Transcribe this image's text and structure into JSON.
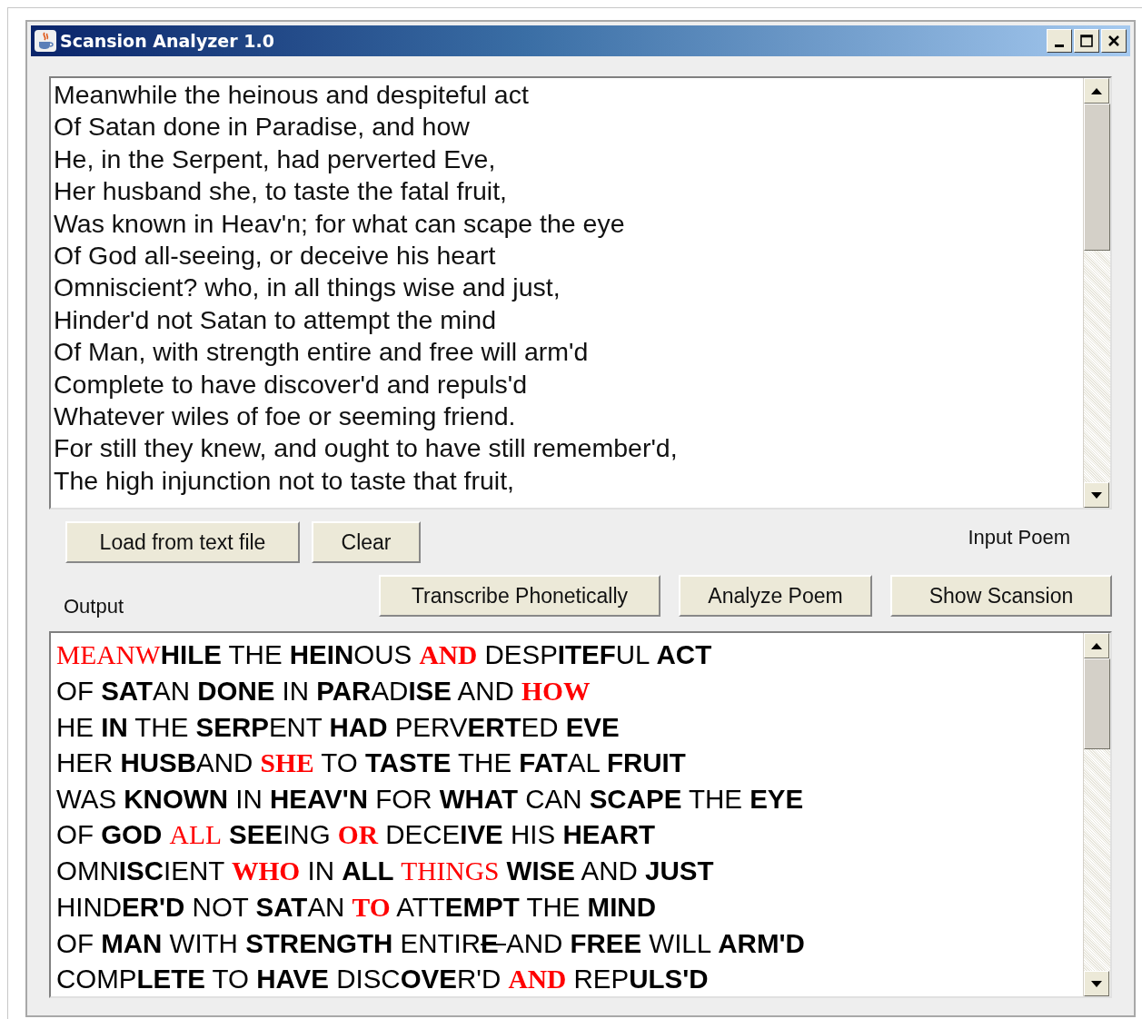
{
  "window": {
    "title": "Scansion Analyzer 1.0"
  },
  "input_poem": {
    "lines": [
      "Meanwhile the heinous and despiteful act",
      "Of Satan done in Paradise, and how",
      "He, in the Serpent, had perverted Eve,",
      "Her husband she, to taste the fatal fruit,",
      "Was known in Heav'n; for what can scape the eye",
      "Of God all-seeing, or deceive his heart",
      "Omniscient? who, in all things wise and just,",
      "Hinder'd not Satan to attempt the mind",
      "Of Man, with strength entire and free will arm'd",
      "Complete to have discover'd and repuls'd",
      "Whatever wiles of foe or seeming friend.",
      "For still they knew, and ought to have still remember'd,",
      "The high injunction not to taste that fruit,"
    ]
  },
  "input_buttons": [
    {
      "label": "Load from text file"
    },
    {
      "label": "Clear"
    }
  ],
  "input_label": "Input Poem",
  "output_label": "Output",
  "output_buttons": [
    {
      "label": "Transcribe Phonetically"
    },
    {
      "label": "Analyze Poem"
    },
    {
      "label": "Show Scansion"
    }
  ],
  "output": {
    "lines": [
      {
        "segments": [
          {
            "text": "MEANW",
            "kind": "red"
          },
          {
            "text": "HILE",
            "kind": "bold"
          },
          {
            "text": " THE ",
            "kind": "plain"
          },
          {
            "text": "HEIN",
            "kind": "bold"
          },
          {
            "text": "OUS ",
            "kind": "plain"
          },
          {
            "text": "AND",
            "kind": "red-bold"
          },
          {
            "text": " DESP",
            "kind": "plain"
          },
          {
            "text": "ITEF",
            "kind": "bold"
          },
          {
            "text": "UL ",
            "kind": "plain"
          },
          {
            "text": "ACT",
            "kind": "bold"
          }
        ]
      },
      {
        "segments": [
          {
            "text": "OF ",
            "kind": "plain"
          },
          {
            "text": "SAT",
            "kind": "bold"
          },
          {
            "text": "AN ",
            "kind": "plain"
          },
          {
            "text": "DONE",
            "kind": "bold"
          },
          {
            "text": " IN ",
            "kind": "plain"
          },
          {
            "text": "PAR",
            "kind": "bold"
          },
          {
            "text": "AD",
            "kind": "plain"
          },
          {
            "text": "ISE",
            "kind": "bold"
          },
          {
            "text": " AND ",
            "kind": "plain"
          },
          {
            "text": "HOW",
            "kind": "red-bold"
          }
        ]
      },
      {
        "segments": [
          {
            "text": "HE ",
            "kind": "plain"
          },
          {
            "text": "IN",
            "kind": "bold"
          },
          {
            "text": " THE ",
            "kind": "plain"
          },
          {
            "text": "SERP",
            "kind": "bold"
          },
          {
            "text": "ENT ",
            "kind": "plain"
          },
          {
            "text": "HAD",
            "kind": "bold"
          },
          {
            "text": " PERV",
            "kind": "plain"
          },
          {
            "text": "ERT",
            "kind": "bold"
          },
          {
            "text": "ED ",
            "kind": "plain"
          },
          {
            "text": "EVE",
            "kind": "bold"
          }
        ]
      },
      {
        "segments": [
          {
            "text": "HER ",
            "kind": "plain"
          },
          {
            "text": "HUSB",
            "kind": "bold"
          },
          {
            "text": "AND ",
            "kind": "plain"
          },
          {
            "text": "SHE",
            "kind": "red-bold"
          },
          {
            "text": " TO ",
            "kind": "plain"
          },
          {
            "text": "TASTE",
            "kind": "bold"
          },
          {
            "text": " THE ",
            "kind": "plain"
          },
          {
            "text": "FAT",
            "kind": "bold"
          },
          {
            "text": "AL ",
            "kind": "plain"
          },
          {
            "text": "FRUIT",
            "kind": "bold"
          }
        ]
      },
      {
        "segments": [
          {
            "text": "WAS ",
            "kind": "plain"
          },
          {
            "text": "KNOWN",
            "kind": "bold"
          },
          {
            "text": " IN ",
            "kind": "plain"
          },
          {
            "text": "HEAV'N",
            "kind": "bold"
          },
          {
            "text": " FOR ",
            "kind": "plain"
          },
          {
            "text": "WHAT",
            "kind": "bold"
          },
          {
            "text": " CAN ",
            "kind": "plain"
          },
          {
            "text": "SCAPE",
            "kind": "bold"
          },
          {
            "text": " THE ",
            "kind": "plain"
          },
          {
            "text": "EYE",
            "kind": "bold"
          }
        ]
      },
      {
        "segments": [
          {
            "text": "OF ",
            "kind": "plain"
          },
          {
            "text": "GOD ",
            "kind": "bold"
          },
          {
            "text": "ALL",
            "kind": "red"
          },
          {
            "text": " SEE",
            "kind": "bold"
          },
          {
            "text": "ING ",
            "kind": "plain"
          },
          {
            "text": "OR",
            "kind": "red-bold"
          },
          {
            "text": " DECE",
            "kind": "plain"
          },
          {
            "text": "IVE",
            "kind": "bold"
          },
          {
            "text": " HIS ",
            "kind": "plain"
          },
          {
            "text": "HEART",
            "kind": "bold"
          }
        ]
      },
      {
        "segments": [
          {
            "text": "OMN",
            "kind": "plain"
          },
          {
            "text": "ISC",
            "kind": "bold"
          },
          {
            "text": "IENT ",
            "kind": "plain"
          },
          {
            "text": "WHO",
            "kind": "red-bold"
          },
          {
            "text": " IN ",
            "kind": "plain"
          },
          {
            "text": "ALL ",
            "kind": "bold"
          },
          {
            "text": "THINGS",
            "kind": "red"
          },
          {
            "text": " WISE",
            "kind": "bold"
          },
          {
            "text": " AND ",
            "kind": "plain"
          },
          {
            "text": "JUST",
            "kind": "bold"
          }
        ]
      },
      {
        "segments": [
          {
            "text": "HIND",
            "kind": "plain"
          },
          {
            "text": "ER'D",
            "kind": "bold"
          },
          {
            "text": " NOT ",
            "kind": "plain"
          },
          {
            "text": "SAT",
            "kind": "bold"
          },
          {
            "text": "AN ",
            "kind": "plain"
          },
          {
            "text": "TO",
            "kind": "red-bold"
          },
          {
            "text": " ATT",
            "kind": "plain"
          },
          {
            "text": "EMPT",
            "kind": "bold"
          },
          {
            "text": " THE ",
            "kind": "plain"
          },
          {
            "text": "MIND",
            "kind": "bold"
          }
        ]
      },
      {
        "segments": [
          {
            "text": "OF ",
            "kind": "plain"
          },
          {
            "text": "MAN",
            "kind": "bold"
          },
          {
            "text": " WITH ",
            "kind": "plain"
          },
          {
            "text": "STRENGTH",
            "kind": "bold"
          },
          {
            "text": " ENTIR",
            "kind": "plain"
          },
          {
            "text": "E ",
            "kind": "bold-struck"
          },
          {
            "text": "AND ",
            "kind": "plain"
          },
          {
            "text": "FREE",
            "kind": "bold"
          },
          {
            "text": " WILL ",
            "kind": "plain"
          },
          {
            "text": "ARM'D",
            "kind": "bold"
          }
        ]
      },
      {
        "segments": [
          {
            "text": "COMP",
            "kind": "plain"
          },
          {
            "text": "LETE",
            "kind": "bold"
          },
          {
            "text": " TO ",
            "kind": "plain"
          },
          {
            "text": "HAVE",
            "kind": "bold"
          },
          {
            "text": " DISC",
            "kind": "plain"
          },
          {
            "text": "OVE",
            "kind": "bold"
          },
          {
            "text": "R'D ",
            "kind": "plain"
          },
          {
            "text": "AND",
            "kind": "red-bold"
          },
          {
            "text": " REP",
            "kind": "plain"
          },
          {
            "text": "ULS'D",
            "kind": "bold"
          }
        ]
      }
    ]
  }
}
